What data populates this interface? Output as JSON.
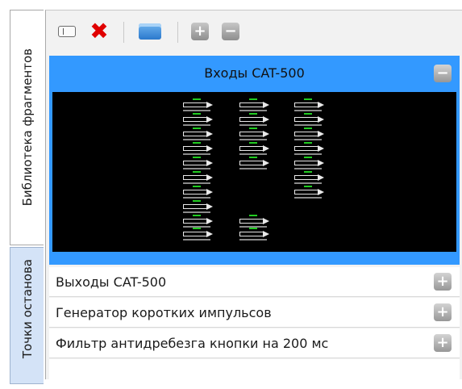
{
  "tabs": [
    {
      "label": "Библиотека фрагментов",
      "active": true
    },
    {
      "label": "Точки останова",
      "active": false
    }
  ],
  "toolbar": {
    "rename_icon": "rename-field-icon",
    "delete_icon": "delete-x-icon",
    "open_icon": "folder-icon",
    "expand_icon": "plus-square-icon",
    "collapse_icon": "minus-square-icon",
    "delete_color": "#e00000"
  },
  "groups": [
    {
      "title": "Входы CAT-500",
      "expanded": true,
      "toggle": "−"
    },
    {
      "title": "Выходы CAT-500",
      "expanded": false,
      "toggle": "+"
    },
    {
      "title": "Генератор коротких импульсов",
      "expanded": false,
      "toggle": "+"
    },
    {
      "title": "Фильтр антидребезга кнопки на 200 мс",
      "expanded": false,
      "toggle": "+"
    }
  ],
  "colors": {
    "selection": "#3399ff",
    "preview_bg": "#000000",
    "wire_green": "#22cc22",
    "inactive_tab": "#d4e3f7"
  }
}
